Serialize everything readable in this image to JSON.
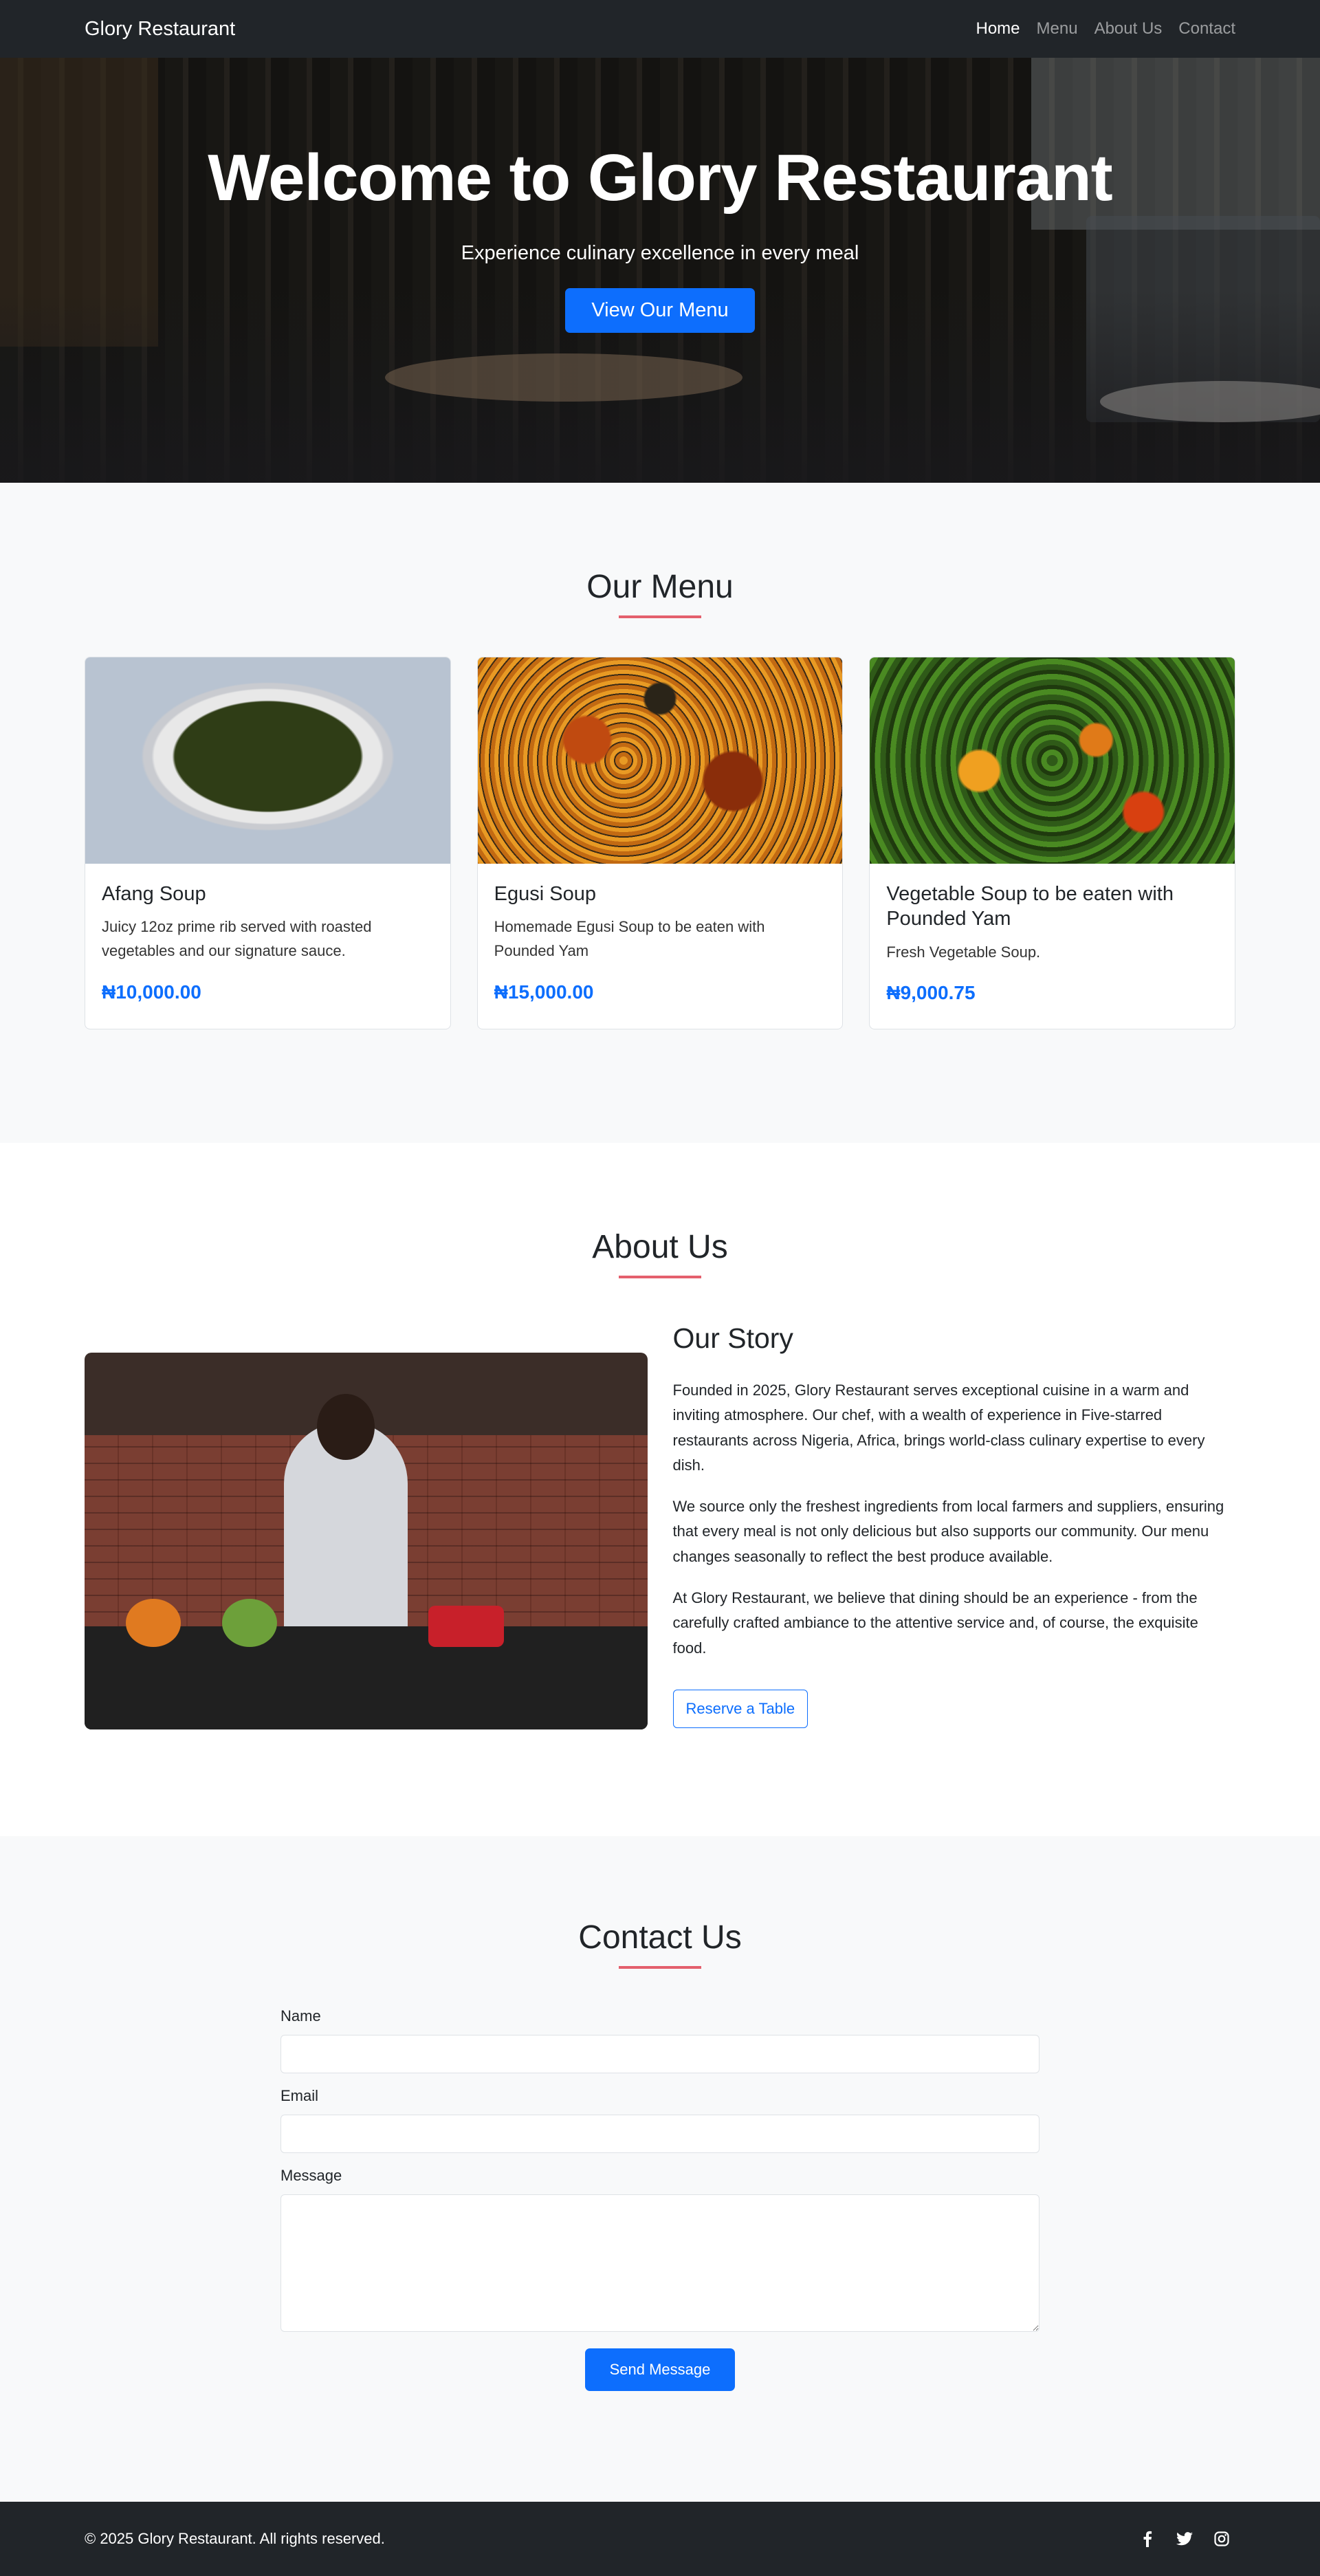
{
  "navbar": {
    "brand": "Glory Restaurant",
    "links": [
      "Home",
      "Menu",
      "About Us",
      "Contact"
    ]
  },
  "hero": {
    "title": "Welcome to Glory Restaurant",
    "subtitle": "Experience culinary excellence in every meal",
    "button": "View Our Menu"
  },
  "menu": {
    "title": "Our Menu",
    "items": [
      {
        "name": "Afang Soup",
        "description": "Juicy 12oz prime rib served with roasted vegetables and our signature sauce.",
        "price": "₦10,000.00"
      },
      {
        "name": "Egusi Soup",
        "description": "Homemade Egusi Soup to be eaten with Pounded Yam",
        "price": "₦15,000.00"
      },
      {
        "name": "Vegetable Soup to be eaten with Pounded Yam",
        "description": "Fresh Vegetable Soup.",
        "price": "₦9,000.75"
      }
    ]
  },
  "about": {
    "title": "About Us",
    "heading": "Our Story",
    "paragraphs": [
      "Founded in 2025, Glory Restaurant serves exceptional cuisine in a warm and inviting atmosphere. Our chef, with a wealth of experience in Five-starred restaurants across Nigeria, Africa, brings world-class culinary expertise to every dish.",
      "We source only the freshest ingredients from local farmers and suppliers, ensuring that every meal is not only delicious but also supports our community. Our menu changes seasonally to reflect the best produce available.",
      "At Glory Restaurant, we believe that dining should be an experience - from the carefully crafted ambiance to the attentive service and, of course, the exquisite food."
    ],
    "button": "Reserve a Table"
  },
  "contact": {
    "title": "Contact Us",
    "name_label": "Name",
    "name_value": "",
    "email_label": "Email",
    "email_value": "",
    "message_label": "Message",
    "message_value": "",
    "button": "Send Message"
  },
  "footer": {
    "copyright": "© 2025 Glory Restaurant. All rights reserved.",
    "social_icons": [
      "facebook-icon",
      "twitter-icon",
      "instagram-icon"
    ]
  },
  "colors": {
    "nav_bg": "#212529",
    "primary": "#0d6efd",
    "accent_underline": "#e4606d",
    "section_alt_bg": "#f8f9fa"
  }
}
